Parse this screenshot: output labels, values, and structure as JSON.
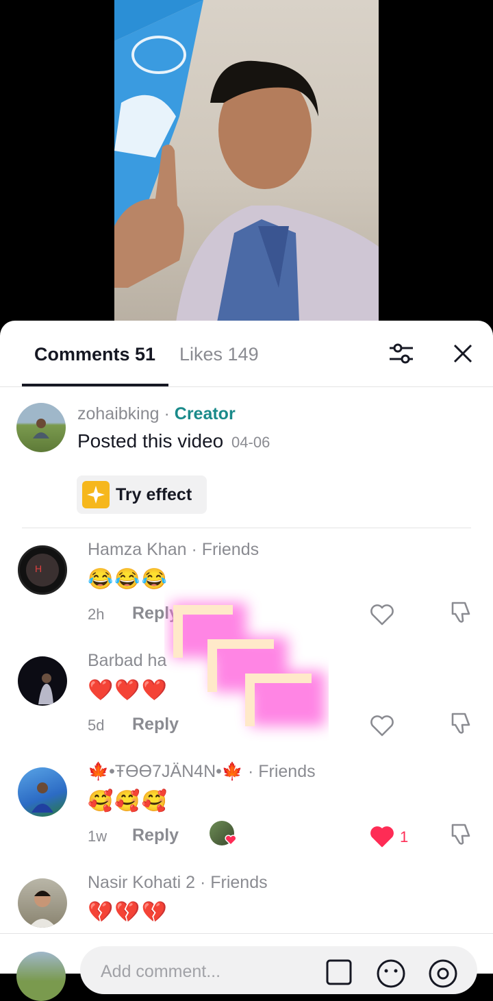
{
  "tabs": {
    "comments": "Comments 51",
    "likes": "Likes 149"
  },
  "creator_post": {
    "username": "zohaibking",
    "separator": "·",
    "badge": "Creator",
    "text": "Posted this video",
    "date": "04-06",
    "effect_button": "Try effect"
  },
  "comments": [
    {
      "name": "Hamza Khan · Friends",
      "text": "😂😂😂",
      "time": "2h",
      "reply": "Reply",
      "likes": "",
      "liked": false
    },
    {
      "name": "Barbad ha",
      "text": "❤️❤️❤️",
      "time": "5d",
      "reply": "Reply",
      "likes": "",
      "liked": false
    },
    {
      "name": "🍁•ŦӨӨ7JÄN4N•🍁 · Friends",
      "text": "🥰🥰🥰",
      "time": "1w",
      "reply": "Reply",
      "likes": "1",
      "liked": true
    },
    {
      "name": "Nasir Kohati 2 · Friends",
      "text": "💔💔💔",
      "time": "",
      "reply": "",
      "likes": "",
      "liked": false
    }
  ],
  "composer": {
    "placeholder": "Add comment..."
  },
  "colors": {
    "accent_pink": "#fe2c55",
    "creator_teal": "#1a8a8a",
    "muted": "#8a8b91"
  },
  "icons": [
    "filter-icon",
    "close-icon",
    "heart-icon",
    "dislike-icon",
    "image-icon",
    "emoji-icon",
    "mention-icon"
  ]
}
